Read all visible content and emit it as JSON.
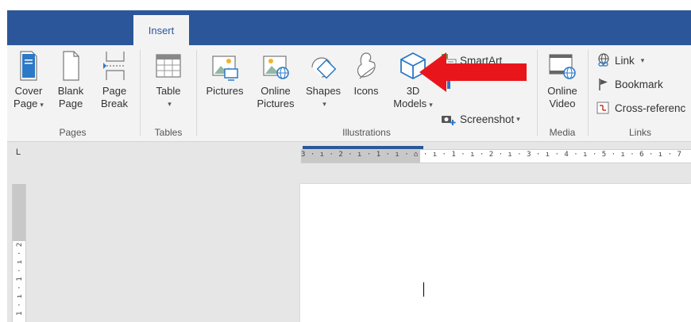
{
  "tabs": {
    "active_label": "Insert"
  },
  "ribbon": {
    "pages_group": {
      "label": "Pages",
      "cover_line1": "Cover",
      "cover_line2": "Page",
      "blank_line1": "Blank",
      "blank_line2": "Page",
      "break_line1": "Page",
      "break_line2": "Break"
    },
    "tables_group": {
      "label": "Tables",
      "table_label": "Table"
    },
    "illustrations_group": {
      "label": "Illustrations",
      "pictures_label": "Pictures",
      "online_line1": "Online",
      "online_line2": "Pictures",
      "shapes_label": "Shapes",
      "icons_label": "Icons",
      "models_line1": "3D",
      "models_line2": "Models",
      "smartart_label": "SmartArt",
      "screenshot_label": "Screenshot"
    },
    "media_group": {
      "label": "Media",
      "video_line1": "Online",
      "video_line2": "Video"
    },
    "links_group": {
      "label": "Links",
      "link_label": "Link",
      "bookmark_label": "Bookmark",
      "crossref_label": "Cross-referenc"
    }
  },
  "ruler": {
    "tab_stop_glyph": "L",
    "horizontal_text": "3 · ı · 2 · ı · 1 · ı · ⌂ · ı · 1 · ı · 2 · ı · 3 · ı · 4 · ı · 5 · ı · 6 · ı · 7",
    "vertical_text": "1 · ı · 1 · ı · 2"
  },
  "colors": {
    "ribbon_blue": "#2b579a",
    "arrow_red": "#e8161b"
  }
}
